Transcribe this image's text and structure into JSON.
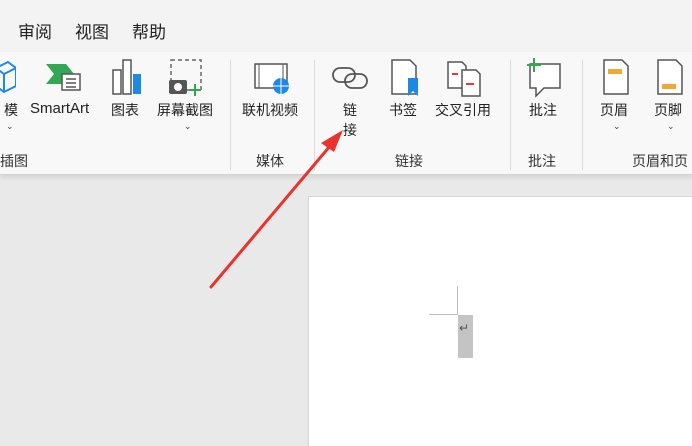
{
  "tabs": [
    "审阅",
    "视图",
    "帮助"
  ],
  "ribbon": {
    "illustrations": {
      "models_label": "模",
      "smartart_label": "SmartArt",
      "chart_label": "图表",
      "screenshot_label": "屏幕截图",
      "group_label": "插图"
    },
    "media": {
      "online_video_label": "联机视频",
      "group_label": "媒体"
    },
    "links": {
      "link_label_line1": "链",
      "link_label_line2": "接",
      "bookmark_label": "书签",
      "cross_reference_label": "交叉引用",
      "group_label": "链接"
    },
    "comments": {
      "comment_label": "批注",
      "group_label": "批注"
    },
    "header_footer": {
      "header_label": "页眉",
      "footer_label": "页脚",
      "group_label": "页眉和页"
    }
  },
  "colors": {
    "accent_green": "#33a852",
    "accent_blue": "#1e88e5",
    "accent_orange": "#f0a830",
    "accent_red": "#e53935",
    "arrow_red": "#e8332e"
  },
  "document": {
    "paragraph_mark": "↵"
  }
}
